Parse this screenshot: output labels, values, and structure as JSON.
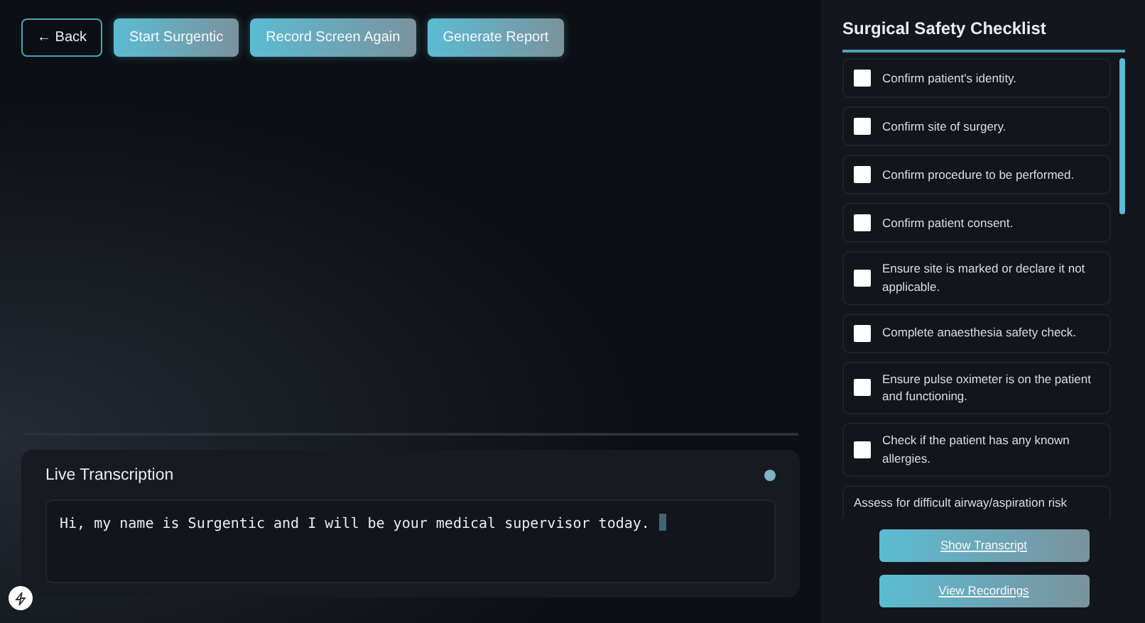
{
  "toolbar": {
    "back": "← Back",
    "buttons": [
      "Start Surgentic",
      "Record Screen Again",
      "Generate Report"
    ]
  },
  "transcription": {
    "title": "Live Transcription",
    "text": "Hi, my name is Surgentic and I will be your medical supervisor today."
  },
  "checklist": {
    "title": "Surgical Safety Checklist",
    "items": [
      {
        "label": "Confirm patient's identity.",
        "checked": false
      },
      {
        "label": "Confirm site of surgery.",
        "checked": false
      },
      {
        "label": "Confirm procedure to be performed.",
        "checked": false
      },
      {
        "label": "Confirm patient consent.",
        "checked": false
      },
      {
        "label": "Ensure site is marked or declare it not applicable.",
        "checked": false
      },
      {
        "label": "Complete anaesthesia safety check.",
        "checked": false
      },
      {
        "label": "Ensure pulse oximeter is on the patient and functioning.",
        "checked": false
      },
      {
        "label": "Check if the patient has any known allergies.",
        "checked": false
      },
      {
        "label": "Assess for difficult airway/aspiration risk"
      }
    ],
    "buttons": [
      "Show Transcript",
      "View Recordings"
    ]
  }
}
